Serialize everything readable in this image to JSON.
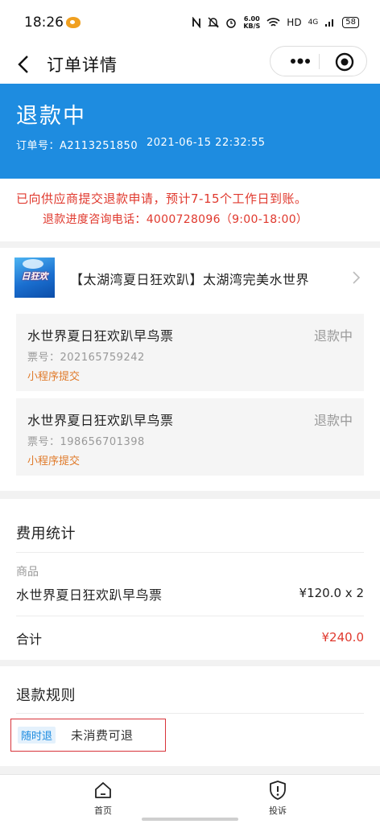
{
  "status_bar": {
    "time": "18:26",
    "speed_value": "6.00",
    "speed_unit": "KB/S",
    "hd": "HD",
    "network": "4G",
    "battery": "58",
    "icons": [
      "weibo-icon",
      "nfc-icon",
      "mute-icon",
      "alarm-icon",
      "wifi-icon",
      "signal-icon"
    ]
  },
  "nav": {
    "title": "订单详情",
    "back_icon": "back-arrow-icon",
    "more_icon": "more-dots-icon",
    "close_icon": "target-circle-icon"
  },
  "header": {
    "status": "退款中",
    "order_no": "订单号：A2113251850",
    "order_time": "2021-06-15 22:32:55",
    "bg_color": "#1e8ce0"
  },
  "notice": {
    "line1": "已向供应商提交退款申请，预计7-15个工作日到账。",
    "line2": "退款进度咨询电话：4000728096（9:00-18:00）",
    "color": "#e0392e"
  },
  "product": {
    "thumb_text": "日狂欢",
    "title": "【太湖湾夏日狂欢趴】太湖湾完美水世界",
    "tickets": [
      {
        "name": "水世界夏日狂欢趴早鸟票",
        "status": "退款中",
        "ticket_no": "票号：202165759242",
        "source": "小程序提交"
      },
      {
        "name": "水世界夏日狂欢趴早鸟票",
        "status": "退款中",
        "ticket_no": "票号：198656701398",
        "source": "小程序提交"
      }
    ]
  },
  "fees": {
    "title": "费用统计",
    "category": "商品",
    "item_name": "水世界夏日狂欢趴早鸟票",
    "item_price": "¥120.0 x 2",
    "total_label": "合计",
    "total_value": "¥240.0"
  },
  "rules": {
    "title": "退款规则",
    "tag": "随时退",
    "text": "未消费可退",
    "highlight_color": "#d8343a"
  },
  "tabs": [
    {
      "label": "首页",
      "icon": "home-icon"
    },
    {
      "label": "投诉",
      "icon": "complaint-shield-icon"
    }
  ]
}
